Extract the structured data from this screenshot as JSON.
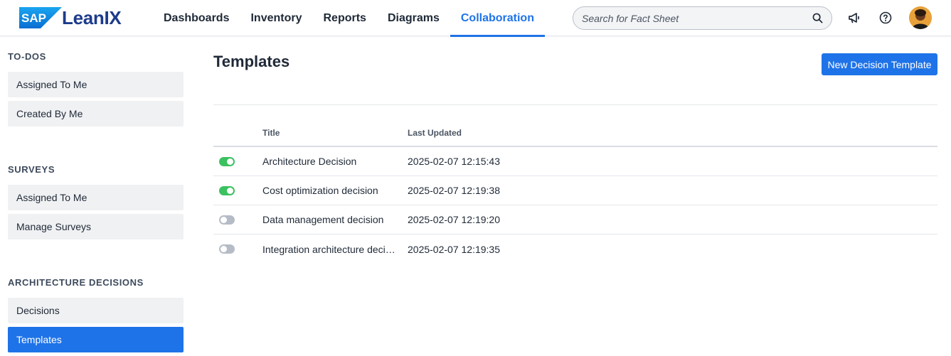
{
  "header": {
    "logo_sap": "SAP",
    "logo_product": "LeanIX",
    "nav": [
      {
        "label": "Dashboards"
      },
      {
        "label": "Inventory"
      },
      {
        "label": "Reports"
      },
      {
        "label": "Diagrams"
      },
      {
        "label": "Collaboration",
        "active": true
      }
    ],
    "search_placeholder": "Search for Fact Sheet",
    "icons": [
      "megaphone-icon",
      "help-icon",
      "user-avatar"
    ]
  },
  "sidebar": {
    "sections": [
      {
        "title": "TO-DOS",
        "items": [
          {
            "label": "Assigned To Me"
          },
          {
            "label": "Created By Me"
          }
        ]
      },
      {
        "title": "SURVEYS",
        "items": [
          {
            "label": "Assigned To Me"
          },
          {
            "label": "Manage Surveys"
          }
        ]
      },
      {
        "title": "ARCHITECTURE DECISIONS",
        "items": [
          {
            "label": "Decisions"
          },
          {
            "label": "Templates",
            "active": true
          }
        ]
      }
    ]
  },
  "main": {
    "title": "Templates",
    "new_button": "New Decision Template",
    "table": {
      "columns": [
        "Title",
        "Last Updated"
      ],
      "rows": [
        {
          "enabled": true,
          "title": "Architecture Decision",
          "updated": "2025-02-07 12:15:43"
        },
        {
          "enabled": true,
          "title": "Cost optimization decision",
          "updated": "2025-02-07 12:19:38"
        },
        {
          "enabled": false,
          "title": "Data management decision",
          "updated": "2025-02-07 12:19:20"
        },
        {
          "enabled": false,
          "title": "Integration architecture decision",
          "updated": "2025-02-07 12:19:35"
        }
      ]
    }
  },
  "colors": {
    "accent": "#1f73e8",
    "toggle_on": "#3bc160",
    "toggle_off": "#b5bcc6",
    "brand_dark": "#1d3b8c"
  }
}
